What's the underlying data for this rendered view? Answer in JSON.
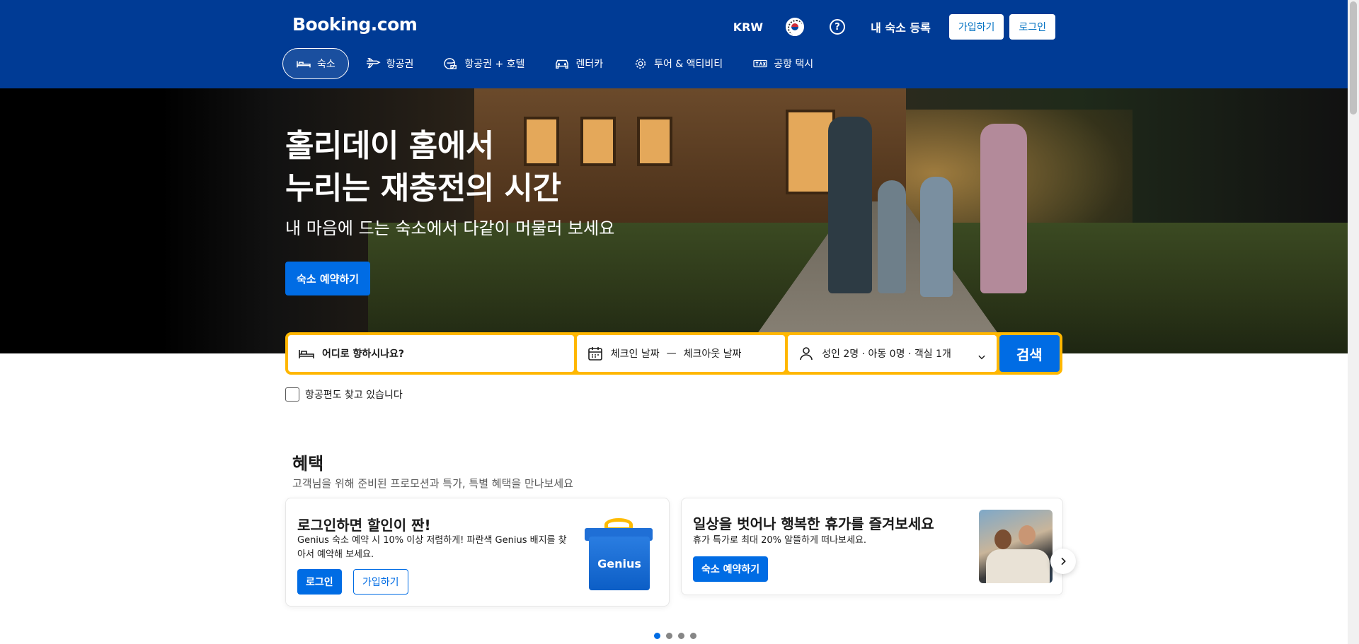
{
  "header": {
    "logo": "Booking.com",
    "currency": "KRW",
    "help_symbol": "?",
    "list_property": "내 숙소 등록",
    "register": "가입하기",
    "signin": "로그인"
  },
  "nav": {
    "items": [
      {
        "label": "숙소",
        "icon": "bed-icon",
        "active": true
      },
      {
        "label": "항공권",
        "icon": "plane-icon"
      },
      {
        "label": "항공권 + 호텔",
        "icon": "plane-hotel-icon"
      },
      {
        "label": "렌터카",
        "icon": "car-icon"
      },
      {
        "label": "투어 & 액티비티",
        "icon": "attraction-icon"
      },
      {
        "label": "공항 택시",
        "icon": "taxi-icon"
      }
    ]
  },
  "hero": {
    "title_line1": "홀리데이 홈에서",
    "title_line2": "누리는 재충전의 시간",
    "subtitle": "내 마음에 드는 숙소에서 다같이 머물러 보세요",
    "cta": "숙소 예약하기"
  },
  "search": {
    "destination_placeholder": "어디로 향하시나요?",
    "checkin": "체크인 날짜",
    "dash": "—",
    "checkout": "체크아웃 날짜",
    "occupancy": "성인 2명 · 아동 0명 · 객실 1개",
    "button": "검색",
    "flight_checkbox": "항공편도 찾고 있습니다"
  },
  "offers": {
    "title": "혜택",
    "subtitle": "고객님을 위해 준비된 프로모션과 특가, 특별 혜택을 만나보세요",
    "card1": {
      "title": "로그인하면 할인이 짠!",
      "text_line1": "Genius 숙소 예약 시 10% 이상 저렴하게! 파란색 Genius 배지를 찾",
      "text_line2": "아서 예약해 보세요.",
      "signin": "로그인",
      "register": "가입하기",
      "badge": "Genius"
    },
    "card2": {
      "title": "일상을 벗어나 행복한 휴가를 즐겨보세요",
      "text": "휴가 특가로 최대 20% 알뜰하게 떠나보세요.",
      "cta": "숙소 예약하기"
    },
    "carousel_dots": 4,
    "active_dot": 0
  },
  "colors": {
    "brand_blue": "#003b95",
    "action_blue": "#006ce4",
    "search_yellow": "#ffb700"
  }
}
